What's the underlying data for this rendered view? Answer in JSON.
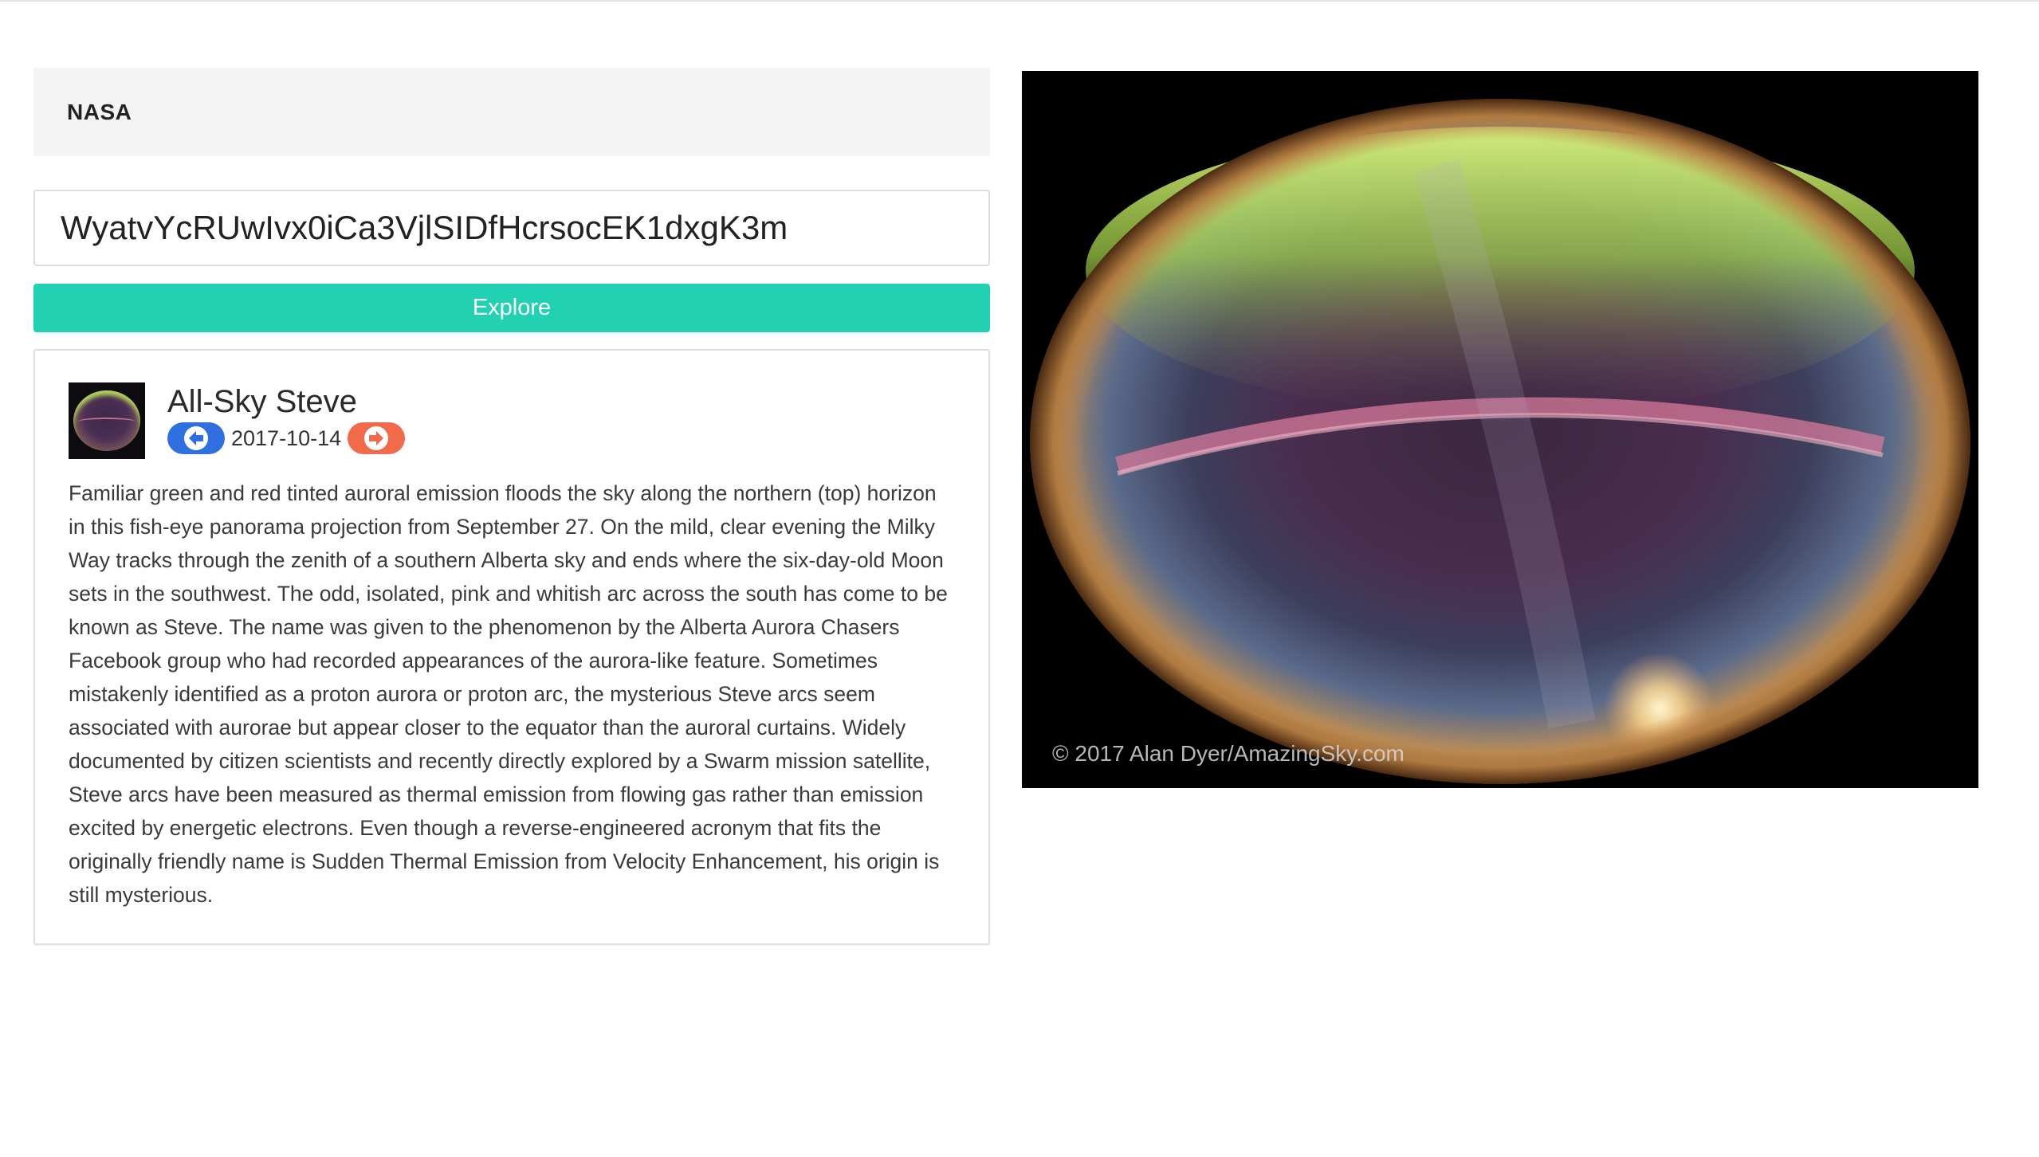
{
  "header": {
    "brand": "NASA"
  },
  "search": {
    "value": "WyatvYcRUwIvx0iCa3VjlSIDfHcrsocEK1dxgK3m"
  },
  "explore_label": "Explore",
  "apod": {
    "title": "All-Sky Steve",
    "date": "2017-10-14",
    "description": "Familiar green and red tinted auroral emission floods the sky along the northern (top) horizon in this fish-eye panorama projection from September 27. On the mild, clear evening the Milky Way tracks through the zenith of a southern Alberta sky and ends where the six-day-old Moon sets in the southwest. The odd, isolated, pink and whitish arc across the south has come to be known as Steve. The name was given to the phenomenon by the Alberta Aurora Chasers Facebook group who had recorded appearances of the aurora-like feature. Sometimes mistakenly identified as a proton aurora or proton arc, the mysterious Steve arcs seem associated with aurorae but appear closer to the equator than the auroral curtains. Widely documented by citizen scientists and recently directly explored by a Swarm mission satellite, Steve arcs have been measured as thermal emission from flowing gas rather than emission excited by energetic electrons. Even though a reverse-engineered acronym that fits the originally friendly name is Sudden Thermal Emission from Velocity Enhancement, his origin is still mysterious.",
    "copyright": "© 2017 Alan Dyer/AmazingSky.com"
  },
  "icons": {
    "prev": "arrow-left-icon",
    "next": "arrow-right-icon"
  },
  "colors": {
    "explore": "#22d0b2",
    "prev": "#2f6fe0",
    "next": "#f26a4c"
  }
}
